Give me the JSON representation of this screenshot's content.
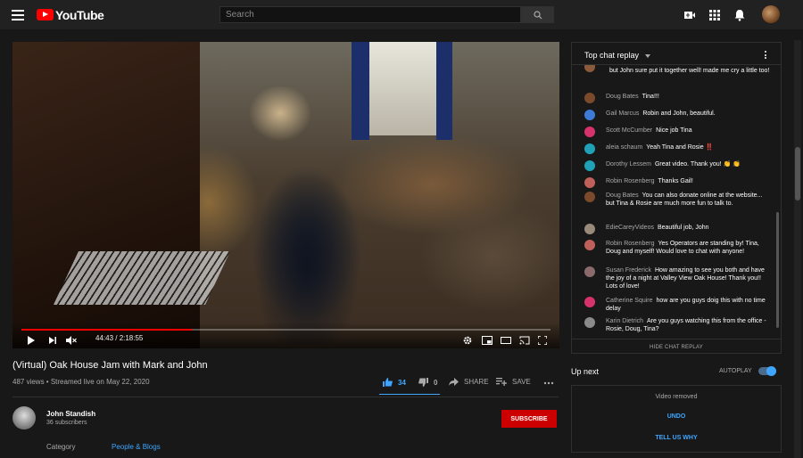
{
  "masthead": {
    "logo_text": "YouTube",
    "search_placeholder": "Search"
  },
  "player": {
    "timecode": "44:43 / 2:18:55",
    "progress": 0.322,
    "accent": "#ff0000"
  },
  "video": {
    "title": "(Virtual) Oak House Jam with Mark and John",
    "views_date": "487 views • Streamed live on May 22, 2020",
    "like_count": "34",
    "dislike_count": "0",
    "share_label": "SHARE",
    "save_label": "SAVE"
  },
  "channel": {
    "name": "John Standish",
    "subscribers": "36 subscribers",
    "subscribe_label": "SUBSCRIBE",
    "category_label": "Category",
    "category_value": "People & Blogs"
  },
  "chat": {
    "title": "Top chat replay",
    "hide_label": "HIDE CHAT REPLAY",
    "messages": [
      {
        "author": "",
        "text": "but John sure put it together well! made me cry a little too!",
        "avatar_color": "#8a5a3a"
      },
      {
        "author": "Doug Bates",
        "text": "Tina!!!",
        "avatar_color": "#7a4a2a"
      },
      {
        "author": "Gail Marcus",
        "text": "Robin and John, beautiful.",
        "avatar_color": "#3e7bd6"
      },
      {
        "author": "Scott McCumber",
        "text": "Nice job Tina",
        "avatar_color": "#d6336c"
      },
      {
        "author": "aleia schaum",
        "text": "Yeah Tina and Rosie ‼️",
        "avatar_color": "#1fa2b8"
      },
      {
        "author": "Dorothy Lessem",
        "text": "Great video. Thank you! 👏 👏",
        "avatar_color": "#1fa2b8"
      },
      {
        "author": "Robin Rosenberg",
        "text": "Thanks Gail!",
        "avatar_color": "#c0605a"
      },
      {
        "author": "Doug Bates",
        "text": "You can also donate online at the website... but Tina & Rosie are much more fun to talk to.",
        "avatar_color": "#7a4a2a"
      },
      {
        "author": "EdieCareyVideos",
        "text": "Beautiful job, John",
        "avatar_color": "#9a8a7a"
      },
      {
        "author": "Robin Rosenberg",
        "text": "Yes Operators are standing by! Tina, Doug and myself! Would love to chat with anyone!",
        "avatar_color": "#c0605a"
      },
      {
        "author": "Susan Frederick",
        "text": "How amazing to see you both and have the joy of a night at Valley View Oak House! Thank you!! Lots of love!",
        "avatar_color": "#8a6a6a"
      },
      {
        "author": "Catherine Squire",
        "text": "how are you guys doig this with no time delay",
        "avatar_color": "#d6336c"
      },
      {
        "author": "Karin Dietrich",
        "text": "Are you guys watching this from the office - Rosie, Doug, Tina?",
        "avatar_color": "#8a8a8a"
      }
    ]
  },
  "sidebar": {
    "up_next": "Up next",
    "autoplay": "AUTOPLAY",
    "removed_text": "Video removed",
    "undo_label": "UNDO",
    "tell_label": "TELL US WHY"
  }
}
